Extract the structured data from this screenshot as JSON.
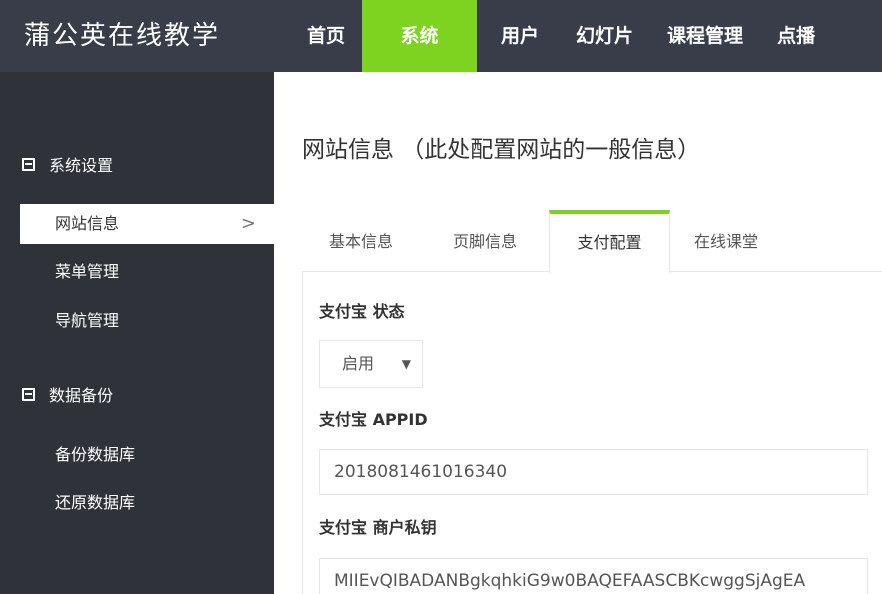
{
  "header": {
    "brand": "蒲公英在线教学",
    "nav": [
      "首页",
      "系统",
      "用户",
      "幻灯片",
      "课程管理",
      "点播"
    ]
  },
  "sidebar": {
    "groups": [
      {
        "label": "系统设置",
        "items": [
          "网站信息",
          "菜单管理",
          "导航管理"
        ]
      },
      {
        "label": "数据备份",
        "items": [
          "备份数据库",
          "还原数据库"
        ]
      }
    ],
    "active_chevron": ">"
  },
  "main": {
    "title": "网站信息 （此处配置网站的一般信息）",
    "tabs": [
      "基本信息",
      "页脚信息",
      "支付配置",
      "在线课堂"
    ],
    "fields": {
      "alipay_status_label": "支付宝 状态",
      "alipay_status_value": "启用",
      "alipay_appid_label": "支付宝 APPID",
      "alipay_appid_value": "2018081461016340",
      "alipay_key_label": "支付宝 商户私钥",
      "alipay_key_value": "MIIEvQIBADANBgkqhkiG9w0BAQEFAASCBKcwggSjAgEA"
    }
  },
  "colors": {
    "accent": "#7ED321",
    "header_bg": "#393D49",
    "sidebar_bg": "#2F3238"
  }
}
